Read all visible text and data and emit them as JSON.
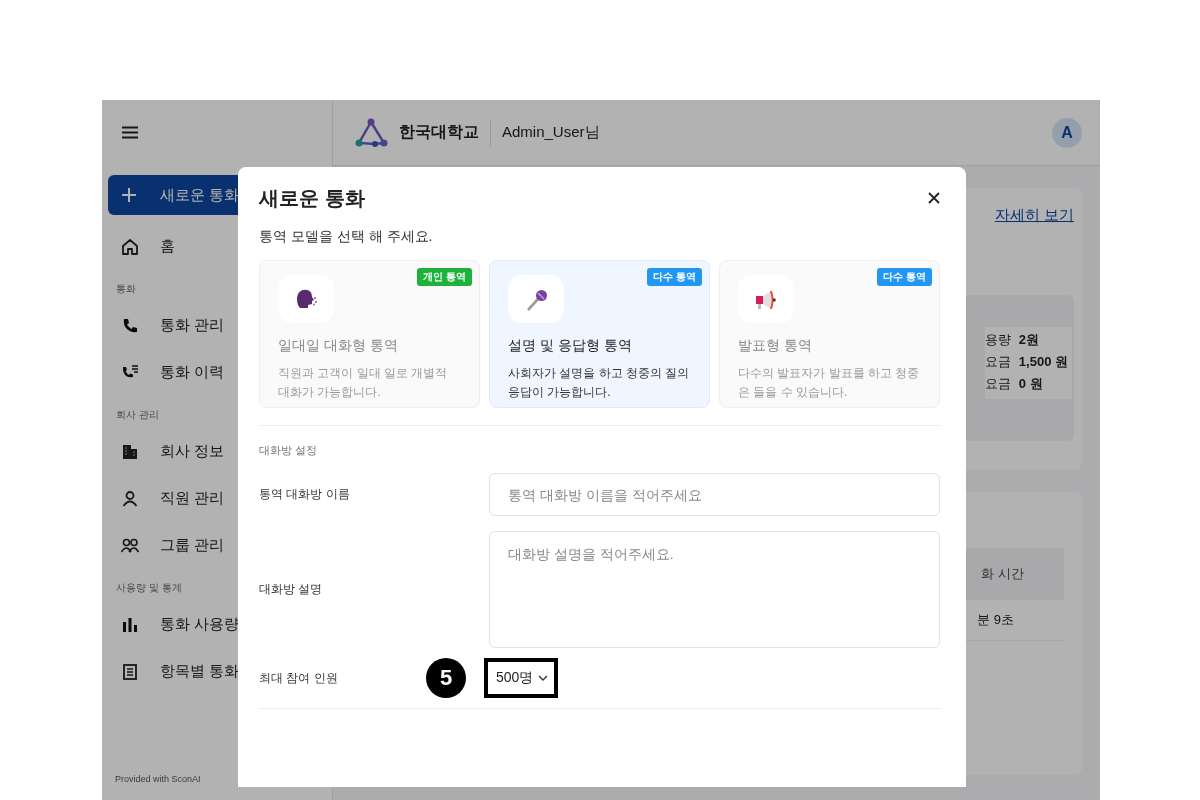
{
  "sidebar": {
    "new_call": "새로운 통화",
    "groups": [
      {
        "items": [
          "홈"
        ]
      },
      {
        "heading": "통화",
        "items": [
          "통화 관리",
          "통화 이력"
        ]
      },
      {
        "heading": "회사 관리",
        "items": [
          "회사 정보",
          "직원 관리",
          "그룹 관리"
        ]
      },
      {
        "heading": "사용량 및 통계",
        "items": [
          "통화 사용량",
          "항목별 통화"
        ]
      }
    ],
    "footer": "Provided with SconAI"
  },
  "header": {
    "brand": "한국대학교",
    "user": "Admin_User님",
    "avatar": "A"
  },
  "main": {
    "detail_link": "자세히 보기",
    "usage_rows": [
      {
        "label": "용량",
        "value": "2원"
      },
      {
        "label": "요금",
        "value": "1,500 원"
      },
      {
        "label": "요금",
        "value": "0 원"
      }
    ],
    "table": {
      "columns": [
        "화 시간"
      ],
      "rows": [
        [
          "분 9초"
        ]
      ]
    }
  },
  "modal": {
    "title": "새로운 통화",
    "subtitle": "통역 모델을 선택 해 주세요.",
    "models": [
      {
        "title": "일대일 대화형 통역",
        "description": "직원과 고객이 일대 일로 개별적 대화가 가능합니다.",
        "badge": "개인 통역",
        "color": "#1db33a",
        "selected": false
      },
      {
        "title": "설명 및 응답형 통역",
        "description": "사회자가 설명을 하고 청중의 질의 응답이 가능합니다.",
        "badge": "다수 통역",
        "color": "#2196f3",
        "selected": true
      },
      {
        "title": "발표형 통역",
        "description": "다수의 발표자가 발표를 하고 청중은 들을 수 있습니다.",
        "badge": "다수 통역",
        "color": "#2196f3",
        "selected": false
      }
    ],
    "section_heading": "대화방 설정",
    "name_field": {
      "label": "통역 대화방 이름",
      "placeholder": "통역 대화방 이름을 적어주세요"
    },
    "description_field": {
      "label": "대화방 설명",
      "placeholder": "대화방 설명을 적어주세요."
    },
    "max_participants": {
      "label": "최대 참여 인원",
      "value": "500명",
      "step_marker": "5"
    }
  }
}
